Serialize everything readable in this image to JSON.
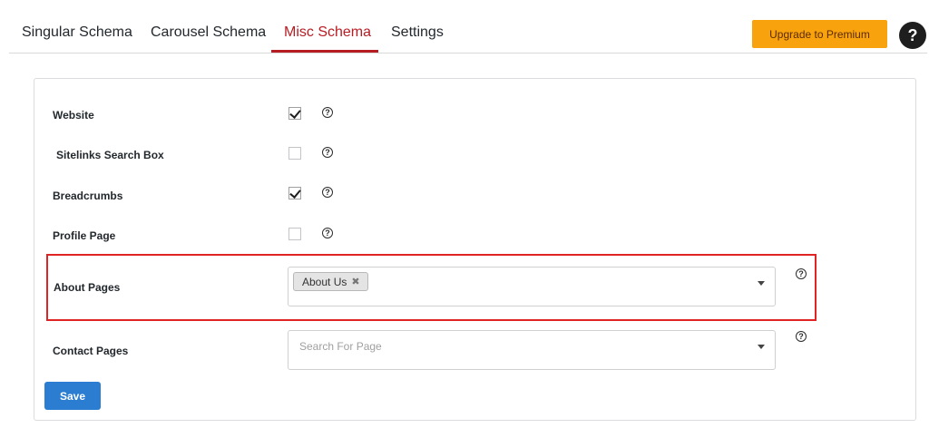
{
  "tabs": [
    {
      "label": "Singular Schema",
      "active": false
    },
    {
      "label": "Carousel Schema",
      "active": false
    },
    {
      "label": "Misc Schema",
      "active": true
    },
    {
      "label": "Settings",
      "active": false
    }
  ],
  "header": {
    "upgrade_label": "Upgrade to Premium",
    "help_glyph": "?"
  },
  "form": {
    "rows": [
      {
        "label": "Website",
        "checked": true
      },
      {
        "label": "Sitelinks Search Box",
        "checked": false
      },
      {
        "label": "Breadcrumbs",
        "checked": true
      },
      {
        "label": "Profile Page",
        "checked": false
      }
    ],
    "about_pages": {
      "label": "About Pages",
      "selected_tag": "About Us",
      "remove_glyph": "✖"
    },
    "contact_pages": {
      "label": "Contact Pages",
      "placeholder": "Search For Page"
    },
    "help_glyph": "?",
    "save_label": "Save"
  },
  "colors": {
    "accent": "#b81c23",
    "upgrade": "#f8a20d",
    "save": "#2a7dd1",
    "highlight": "#e02424"
  }
}
